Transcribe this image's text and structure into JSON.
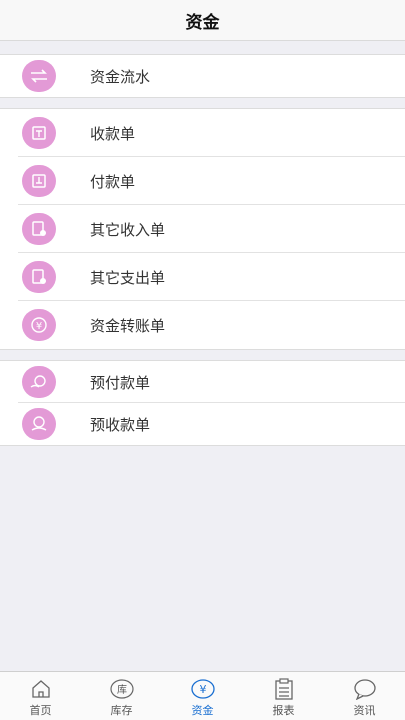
{
  "header": {
    "title": "资金"
  },
  "groups": [
    {
      "items": [
        {
          "label": "资金流水",
          "icon": "transfer-arrows-icon"
        }
      ]
    },
    {
      "items": [
        {
          "label": "收款单",
          "icon": "receipt-in-icon"
        },
        {
          "label": "付款单",
          "icon": "receipt-out-icon"
        },
        {
          "label": "其它收入单",
          "icon": "other-income-icon"
        },
        {
          "label": "其它支出单",
          "icon": "other-expense-icon"
        },
        {
          "label": "资金转账单",
          "icon": "yen-transfer-icon"
        }
      ]
    },
    {
      "items": [
        {
          "label": "预付款单",
          "icon": "prepay-icon"
        },
        {
          "label": "预收款单",
          "icon": "prereceive-icon"
        }
      ]
    }
  ],
  "tabbar": {
    "tabs": [
      {
        "label": "首页",
        "icon": "home-icon",
        "glyph": ""
      },
      {
        "label": "库存",
        "icon": "warehouse-icon",
        "glyph": "库"
      },
      {
        "label": "资金",
        "icon": "yen-icon",
        "glyph": "¥"
      },
      {
        "label": "报表",
        "icon": "clipboard-icon",
        "glyph": ""
      },
      {
        "label": "资讯",
        "icon": "chat-bubble-icon",
        "glyph": ""
      }
    ],
    "active": "资金"
  },
  "colors": {
    "icon_bg": "#e39ad6",
    "active_tab": "#1a6fd1",
    "background": "#efeff4"
  }
}
